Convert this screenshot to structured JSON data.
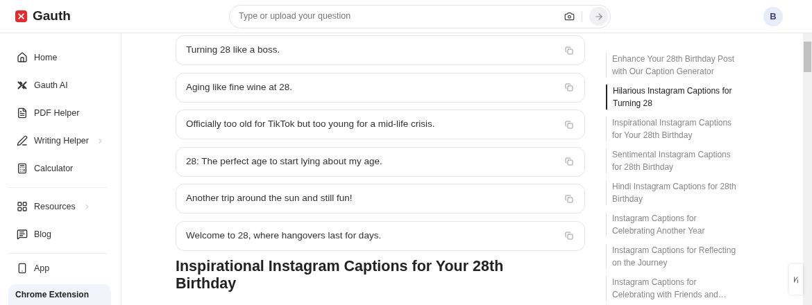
{
  "header": {
    "logo": "Gauth",
    "search": {
      "placeholder": "Type or upload your question"
    },
    "avatar": "B"
  },
  "sidebar": {
    "groups": [
      [
        {
          "label": "Home",
          "has_submenu": false
        },
        {
          "label": "Gauth AI",
          "has_submenu": false
        },
        {
          "label": "PDF Helper",
          "has_submenu": false
        },
        {
          "label": "Writing Helper",
          "has_submenu": true
        },
        {
          "label": "Calculator",
          "has_submenu": false
        }
      ],
      [
        {
          "label": "Resources",
          "has_submenu": true
        },
        {
          "label": "Blog",
          "has_submenu": false
        }
      ],
      [
        {
          "label": "App",
          "has_submenu": false
        }
      ]
    ],
    "banner": "Chrome Extension"
  },
  "captions": [
    "Turning 28 like a boss.",
    "Aging like fine wine at 28.",
    "Officially too old for TikTok but too young for a mid-life crisis.",
    "28: The perfect age to start lying about my age.",
    "Another trip around the sun and still fun!",
    "Welcome to 28, where hangovers last for days."
  ],
  "section_heading": "Inspirational Instagram Captions for Your 28th Birthday",
  "toc": [
    {
      "label": "Enhance Your 28th Birthday Post with Our Caption Generator",
      "selected": false
    },
    {
      "label": "Hilarious Instagram Captions for Turning 28",
      "selected": true
    },
    {
      "label": "Inspirational Instagram Captions for Your 28th Birthday",
      "selected": false
    },
    {
      "label": "Sentimental Instagram Captions for 28th Birthday",
      "selected": false
    },
    {
      "label": "Hindi Instagram Captions for 28th Birthday",
      "selected": false
    },
    {
      "label": "Instagram Captions for Celebrating Another Year",
      "selected": false
    },
    {
      "label": "Instagram Captions for Reflecting on the Journey",
      "selected": false
    },
    {
      "label": "Instagram Captions for Celebrating with Friends and…",
      "selected": false
    }
  ]
}
